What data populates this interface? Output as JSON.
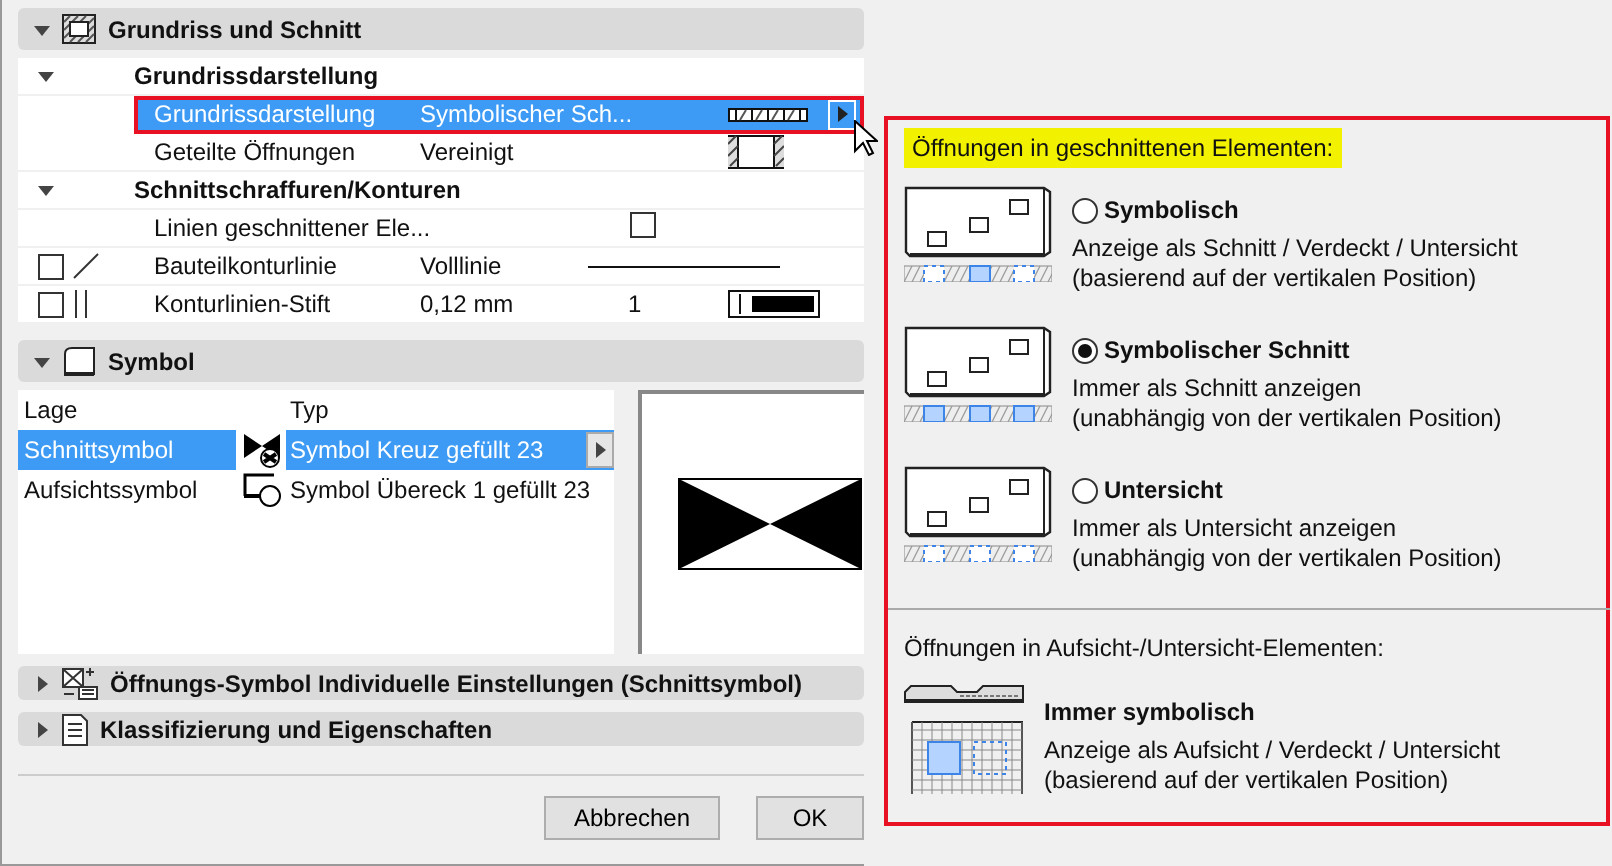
{
  "panels": [
    {
      "kind": "floor-plan",
      "title": "Grundriss und Schnitt",
      "expanded": true,
      "groups": [
        {
          "title": "Grundrissdarstellung",
          "expanded": true,
          "rows": [
            {
              "kind": "hatch",
              "label": "Grundrissdarstellung",
              "value": "Symbolischer Sch...",
              "selected": true,
              "annotated": true
            },
            {
              "kind": "opening",
              "label": "Geteilte Öffnungen",
              "value": "Vereinigt",
              "selected": false,
              "annotated": false
            }
          ]
        },
        {
          "title": "Schnittschraffuren/Konturen",
          "expanded": true,
          "rows": [
            {
              "kind": "checkbox",
              "label": "Linien geschnittener Ele...",
              "checked": false,
              "selected": false
            },
            {
              "kind": "line",
              "label": "Bauteilkonturlinie",
              "value": "Volllinie",
              "lead_checked": false,
              "selected": false
            },
            {
              "kind": "pen",
              "label": "Konturlinien-Stift",
              "value": "0,12 mm",
              "number": "1",
              "lead_checked": false,
              "selected": false
            }
          ]
        }
      ]
    },
    {
      "kind": "symbol",
      "title": "Symbol",
      "expanded": true,
      "columns": [
        "Lage",
        "Typ"
      ],
      "rows": [
        {
          "position": "Schnittsymbol",
          "type": "Symbol Kreuz gefüllt 23",
          "selected": true
        },
        {
          "position": "Aufsichtssymbol",
          "type": "Symbol Übereck 1 gefüllt 23",
          "selected": false
        }
      ]
    },
    {
      "kind": "symbol-settings",
      "title": "Öffnungs-Symbol Individuelle Einstellungen (Schnittsymbol)",
      "expanded": false
    },
    {
      "kind": "classification",
      "title": "Klassifizierung und Eigenschaften",
      "expanded": false
    }
  ],
  "buttons": [
    "Abbrechen",
    "OK"
  ],
  "popup": {
    "heading": "Öffnungen in geschnittenen Elementen:",
    "options": [
      {
        "label": "Symbolisch",
        "selected": false,
        "lines": [
          "Anzeige als Schnitt / Verdeckt / Untersicht",
          "(basierend auf der vertikalen Position)"
        ]
      },
      {
        "label": "Symbolischer Schnitt",
        "selected": true,
        "lines": [
          "Immer als Schnitt anzeigen",
          "(unabhängig von der vertikalen Position)"
        ]
      },
      {
        "label": "Untersicht",
        "selected": false,
        "lines": [
          "Immer als Untersicht anzeigen",
          "(unabhängig von der vertikalen Position)"
        ]
      }
    ],
    "heading2": "Öffnungen in Aufsicht-/Untersicht-Elementen:",
    "fixed": {
      "label": "Immer symbolisch",
      "lines": [
        "Anzeige als Aufsicht / Verdeckt / Untersicht",
        "(basierend auf der vertikalen Position)"
      ]
    }
  }
}
